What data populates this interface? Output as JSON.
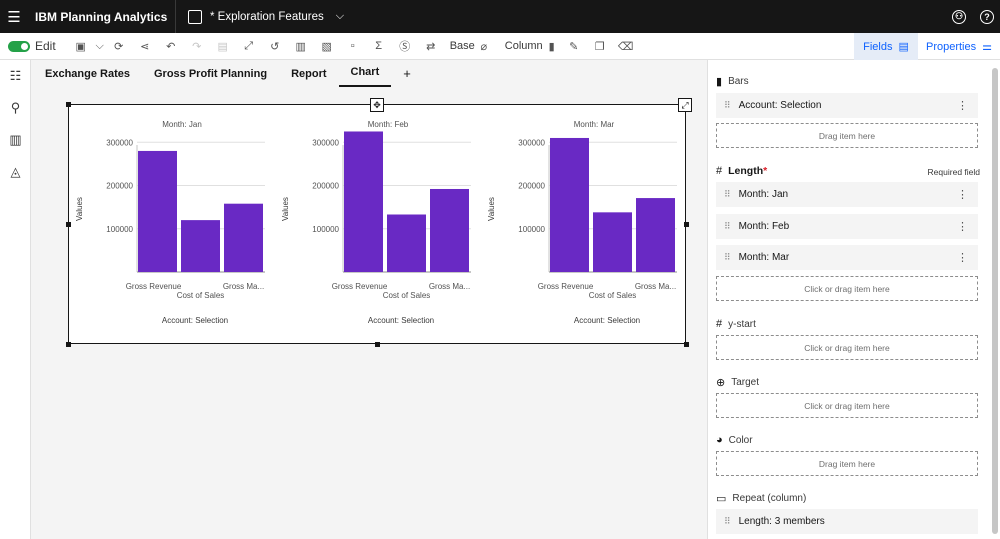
{
  "app": {
    "brand": "IBM Planning Analytics",
    "document": "* Exploration Features"
  },
  "toolbar": {
    "edit_label": "Edit",
    "base_label": "Base",
    "column_label": "Column"
  },
  "panel_tabs": {
    "fields": "Fields",
    "properties": "Properties"
  },
  "tabs": [
    {
      "label": "Exchange Rates"
    },
    {
      "label": "Gross Profit Planning"
    },
    {
      "label": "Report"
    },
    {
      "label": "Chart"
    },
    {
      "label": "+"
    }
  ],
  "chart_data": [
    {
      "type": "bar",
      "title": "Month: Jan",
      "categories": [
        "Gross Revenue",
        "Cost of Sales",
        "Gross Ma..."
      ],
      "values": [
        280000,
        120000,
        158000
      ],
      "ylabel": "Values",
      "xlabel": "Account: Selection",
      "yticks": [
        "300000",
        "200000",
        "100000"
      ],
      "ylim": [
        0,
        340000
      ],
      "color": "#6929c4"
    },
    {
      "type": "bar",
      "title": "Month: Feb",
      "categories": [
        "Gross Revenue",
        "Cost of Sales",
        "Gross Ma..."
      ],
      "values": [
        325000,
        133000,
        192000
      ],
      "ylabel": "Values",
      "xlabel": "Account: Selection",
      "yticks": [
        "300000",
        "200000",
        "100000"
      ],
      "ylim": [
        0,
        340000
      ],
      "color": "#6929c4"
    },
    {
      "type": "bar",
      "title": "Month: Mar",
      "categories": [
        "Gross Revenue",
        "Cost of Sales",
        "Gross Ma..."
      ],
      "values": [
        310000,
        138000,
        171000
      ],
      "ylabel": "Values",
      "xlabel": "Account: Selection",
      "yticks": [
        "300000",
        "200000",
        "100000"
      ],
      "ylim": [
        0,
        340000
      ],
      "color": "#6929c4"
    }
  ],
  "fields": {
    "bars": {
      "label": "Bars",
      "item": "Account: Selection",
      "drop": "Drag item here"
    },
    "length": {
      "label": "Length",
      "asterisk": "*",
      "required": "Required field",
      "items": [
        "Month: Jan",
        "Month: Feb",
        "Month: Mar"
      ],
      "drop": "Click or drag item here"
    },
    "ystart": {
      "label": "y-start",
      "drop": "Click or drag item here"
    },
    "target": {
      "label": "Target",
      "drop": "Click or drag item here"
    },
    "color": {
      "label": "Color",
      "drop": "Drag item here"
    },
    "repeat": {
      "label": "Repeat (column)",
      "item": "Length: 3 members"
    }
  }
}
